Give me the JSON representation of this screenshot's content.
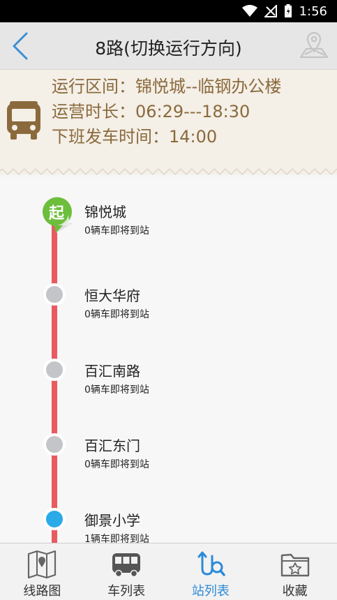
{
  "status": {
    "time": "1:56"
  },
  "header": {
    "title": "8路(切换运行方向)"
  },
  "info": {
    "range_line": "运行区间：锦悦城--临钢办公楼",
    "hours_line": "运营时长：06:29---18:30",
    "last_line": "下班发车时间：14:00"
  },
  "route": {
    "start_badge": "起",
    "stops": [
      {
        "name": "锦悦城",
        "status": "0辆车即将到站"
      },
      {
        "name": "恒大华府",
        "status": "0辆车即将到站"
      },
      {
        "name": "百汇南路",
        "status": "0辆车即将到站"
      },
      {
        "name": "百汇东门",
        "status": "0辆车即将到站"
      },
      {
        "name": "御景小学",
        "status": "1辆车即将到站"
      }
    ]
  },
  "tabs": [
    {
      "label": "线路图",
      "icon": "map-icon"
    },
    {
      "label": "车列表",
      "icon": "bus-icon"
    },
    {
      "label": "站列表",
      "icon": "route-search-icon",
      "active": true
    },
    {
      "label": "收藏",
      "icon": "favorite-folder-icon"
    }
  ],
  "colors": {
    "accent": "#2a8ad8",
    "rail": "#e95a5f",
    "info_text": "#8a6a3c",
    "current": "#2aaae8",
    "start": "#6cbe3c"
  }
}
